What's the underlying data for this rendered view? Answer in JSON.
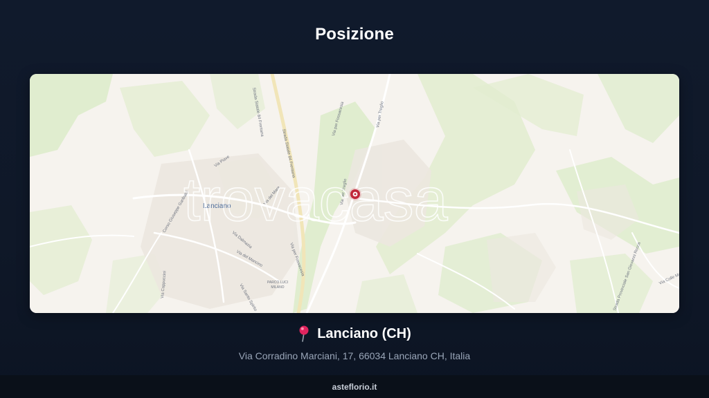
{
  "page": {
    "title": "Posizione"
  },
  "map": {
    "watermark": "trovacasa",
    "city_label": "Lanciano",
    "park_label_line1": "PARCO LUCI",
    "park_label_line2": "MILANO",
    "street_labels": [
      "Strada Statale 84 Frentana",
      "Strada Statale 84 Frentana",
      "Via per Treglio",
      "Via per Treglio",
      "Via Piave",
      "Via del Mare",
      "Corso Giuseppe Garibaldi",
      "Via Dalmazia",
      "Via per Fossacesia",
      "Via per Fossacesia",
      "Via del Mancino",
      "Via Santo Spirito",
      "Via Cappuccini",
      "Strada Provinciale San Giovanni Rocca",
      "Via Colle Marconi"
    ],
    "marker_icon": "location-marker-icon",
    "colors": {
      "land": "#f6f3ee",
      "greenery": "#dfeccd",
      "marker": "#c0283a"
    }
  },
  "location": {
    "icon": "pushpin-icon",
    "title": "Lanciano (CH)",
    "address": "Via Corradino Marciani, 17, 66034 Lanciano CH, Italia"
  },
  "footer": {
    "site": "asteflorio.it"
  }
}
